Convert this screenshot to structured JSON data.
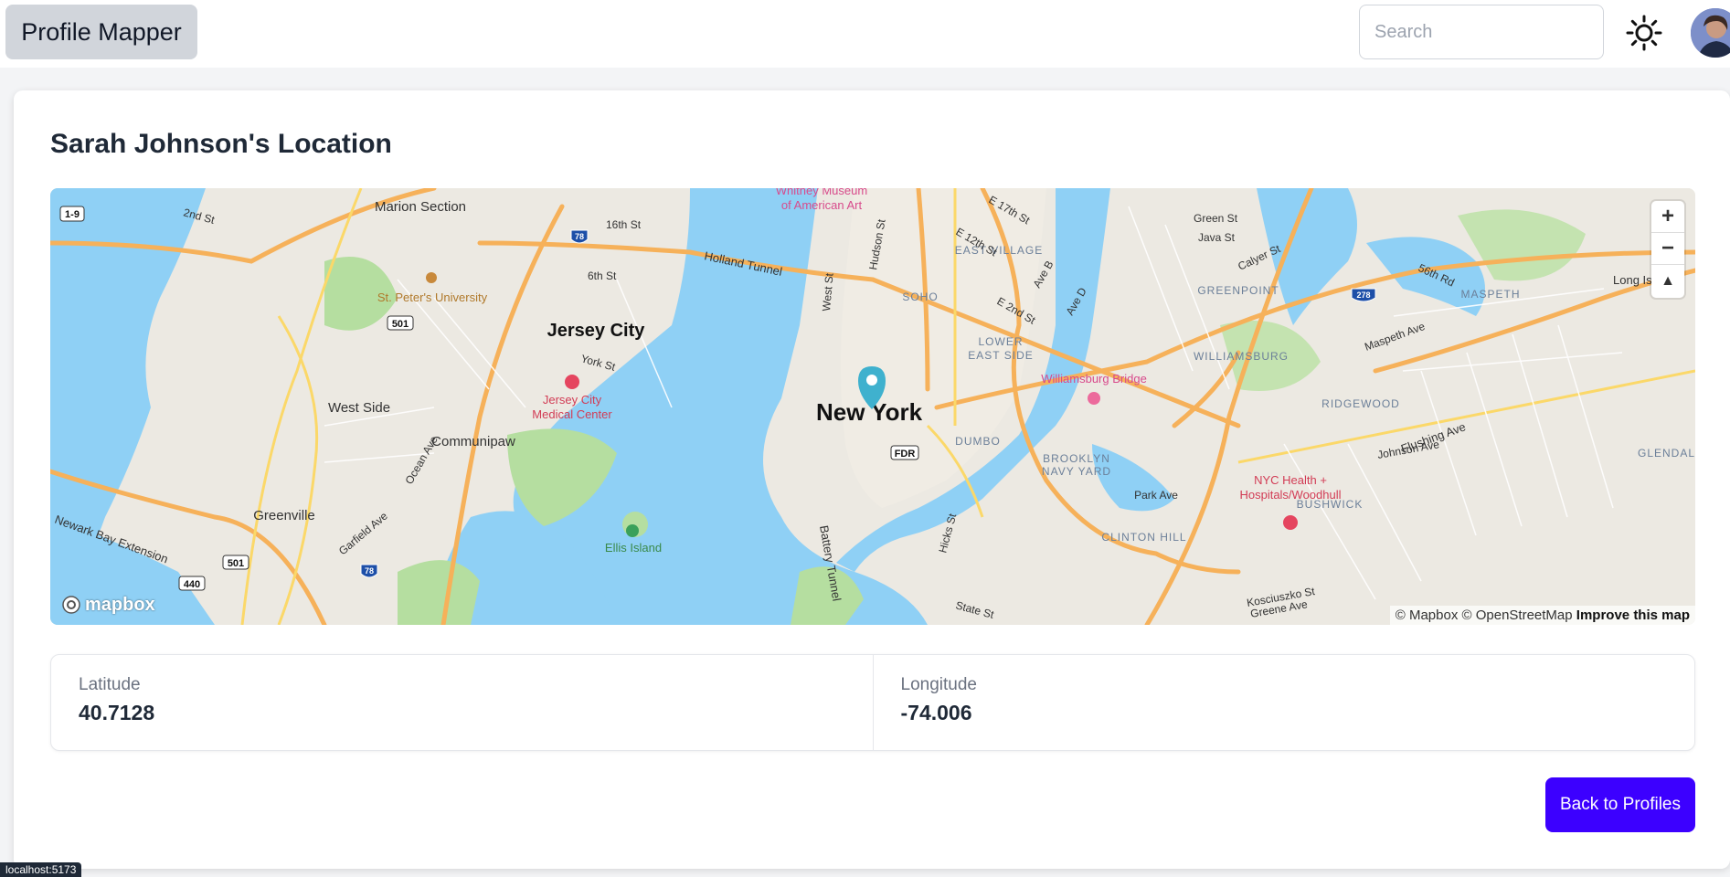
{
  "navbar": {
    "brand": "Profile Mapper",
    "search_placeholder": "Search",
    "theme_icon": "sun-icon",
    "avatar_icon": "avatar"
  },
  "profile": {
    "title": "Sarah Johnson's Location",
    "latitude_label": "Latitude",
    "latitude": "40.7128",
    "longitude_label": "Longitude",
    "longitude": "-74.006",
    "back_label": "Back to Profiles"
  },
  "map": {
    "labels": {
      "new_york": "New York",
      "jersey_city": "Jersey City",
      "marion_section": "Marion Section",
      "st_peters": "St. Peter's University",
      "west_side": "West Side",
      "communipaw": "Communipaw",
      "greenville": "Greenville",
      "ellis_island": "Ellis Island",
      "jc_medical": "Jersey City",
      "jc_medical_2": "Medical Center",
      "whitney": "Whitney Museum",
      "whitney_2": "of American Art",
      "holland_tunnel": "Holland Tunnel",
      "east_village": "EAST VILLAGE",
      "soho": "SOHO",
      "lower_east_side": "LOWER",
      "lower_east_side_2": "EAST SIDE",
      "williamsburg_bridge": "Williamsburg Bridge",
      "williamsburg": "WILLIAMSBURG",
      "greenpoint": "GREENPOINT",
      "maspeth": "MASPETH",
      "ridgewood": "RIDGEWOOD",
      "bushwick": "BUSHWICK",
      "dumbo": "DUMBO",
      "brooklyn_navy_yard": "BROOKLYN",
      "brooklyn_navy_yard_2": "NAVY YARD",
      "clinton_hill": "CLINTON HILL",
      "nyc_health": "NYC Health +",
      "nyc_health_2": "Hospitals/Woodhull",
      "glendale": "GLENDALE",
      "battery_tunnel": "Battery Tunnel",
      "newark_bay": "Newark Bay Extension",
      "hudson_st": "Hudson St",
      "west_st": "West St",
      "fdr": "FDR",
      "park_ave": "Park Ave",
      "flushing_ave": "Flushing Ave",
      "long_island": "Long Island",
      "sixth_st": "6th St",
      "sixteenth_st": "16th St",
      "second_st": "2nd St",
      "york_st": "York St",
      "ocean_ave": "Ocean Ave",
      "garfield_ave": "Garfield Ave",
      "fifty_sixth_rd": "56th Rd",
      "maspeth_ave": "Maspeth Ave",
      "johnson_ave": "Johnson Ave",
      "greene_ave": "Greene Ave",
      "kosciuszko": "Kosciuszko St",
      "state_st": "State St",
      "hicks_st": "Hicks St",
      "green_st": "Green St",
      "java_st": "Java St",
      "calyer_st": "Calyer St",
      "ave_b": "Ave B",
      "ave_d": "Ave D",
      "e_second": "E 2nd St",
      "e_twelfth": "E 12th St",
      "e_seventeenth": "E 17th St",
      "i78": "78",
      "i278": "278",
      "r501": "501",
      "r440": "440",
      "r1_9": "1-9",
      "truck1": "1"
    },
    "zoom_in": "+",
    "zoom_out": "−",
    "compass": "▲",
    "logo": "mapbox",
    "attribution": "© Mapbox © OpenStreetMap",
    "improve": "Improve this map"
  },
  "status_url": "localhost:5173"
}
